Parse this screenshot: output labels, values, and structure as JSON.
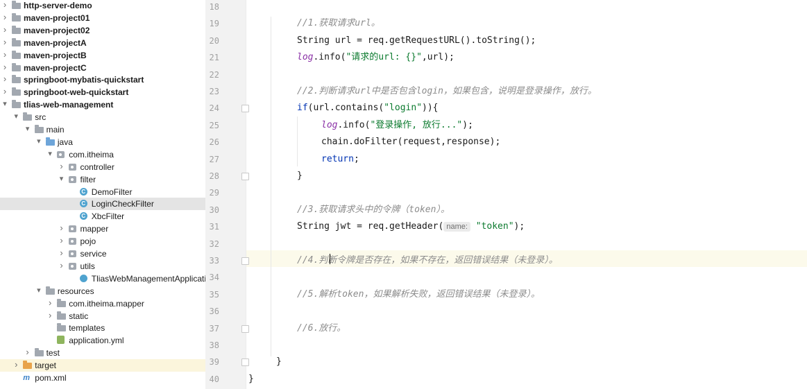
{
  "project_tree": {
    "items": [
      {
        "label": "http-server-demo",
        "bold": true,
        "level": 0,
        "arrow": "›",
        "icon": "folder"
      },
      {
        "label": "maven-project01",
        "bold": true,
        "level": 0,
        "arrow": "›",
        "icon": "folder"
      },
      {
        "label": "maven-project02",
        "bold": true,
        "level": 0,
        "arrow": "›",
        "icon": "folder"
      },
      {
        "label": "maven-projectA",
        "bold": true,
        "level": 0,
        "arrow": "›",
        "icon": "folder"
      },
      {
        "label": "maven-projectB",
        "bold": true,
        "level": 0,
        "arrow": "›",
        "icon": "folder"
      },
      {
        "label": "maven-projectC",
        "bold": true,
        "level": 0,
        "arrow": "›",
        "icon": "folder"
      },
      {
        "label": "springboot-mybatis-quickstart",
        "bold": true,
        "level": 0,
        "arrow": "›",
        "icon": "folder"
      },
      {
        "label": "springboot-web-quickstart",
        "bold": true,
        "level": 0,
        "arrow": "›",
        "icon": "folder"
      },
      {
        "label": "tlias-web-management",
        "bold": true,
        "level": 0,
        "arrow": "⌄",
        "icon": "folder"
      },
      {
        "label": "src",
        "bold": false,
        "level": 1,
        "arrow": "⌄",
        "icon": "folder"
      },
      {
        "label": "main",
        "bold": false,
        "level": 2,
        "arrow": "⌄",
        "icon": "folder"
      },
      {
        "label": "java",
        "bold": false,
        "level": 3,
        "arrow": "⌄",
        "icon": "folder-blue"
      },
      {
        "label": "com.itheima",
        "bold": false,
        "level": 4,
        "arrow": "⌄",
        "icon": "package"
      },
      {
        "label": "controller",
        "bold": false,
        "level": 5,
        "arrow": "›",
        "icon": "package"
      },
      {
        "label": "filter",
        "bold": false,
        "level": 5,
        "arrow": "⌄",
        "icon": "package"
      },
      {
        "label": "DemoFilter",
        "bold": false,
        "level": 6,
        "arrow": "",
        "icon": "class"
      },
      {
        "label": "LoginCheckFilter",
        "bold": false,
        "level": 6,
        "arrow": "",
        "icon": "class",
        "selected": true
      },
      {
        "label": "XbcFilter",
        "bold": false,
        "level": 6,
        "arrow": "",
        "icon": "class"
      },
      {
        "label": "mapper",
        "bold": false,
        "level": 5,
        "arrow": "›",
        "icon": "package"
      },
      {
        "label": "pojo",
        "bold": false,
        "level": 5,
        "arrow": "›",
        "icon": "package"
      },
      {
        "label": "service",
        "bold": false,
        "level": 5,
        "arrow": "›",
        "icon": "package"
      },
      {
        "label": "utils",
        "bold": false,
        "level": 5,
        "arrow": "›",
        "icon": "package"
      },
      {
        "label": "TliasWebManagementApplication",
        "bold": false,
        "level": 6,
        "arrow": "",
        "icon": "app"
      },
      {
        "label": "resources",
        "bold": false,
        "level": 3,
        "arrow": "⌄",
        "icon": "folder"
      },
      {
        "label": "com.itheima.mapper",
        "bold": false,
        "level": 4,
        "arrow": "›",
        "icon": "folder"
      },
      {
        "label": "static",
        "bold": false,
        "level": 4,
        "arrow": "›",
        "icon": "folder"
      },
      {
        "label": "templates",
        "bold": false,
        "level": 4,
        "arrow": "",
        "icon": "folder"
      },
      {
        "label": "application.yml",
        "bold": false,
        "level": 4,
        "arrow": "",
        "icon": "yml"
      },
      {
        "label": "test",
        "bold": false,
        "level": 2,
        "arrow": "›",
        "icon": "folder"
      },
      {
        "label": "target",
        "bold": false,
        "level": 1,
        "arrow": "›",
        "icon": "folder-orange",
        "highlight": true
      },
      {
        "label": "pom.xml",
        "bold": false,
        "level": 1,
        "arrow": "",
        "icon": "maven"
      }
    ]
  },
  "editor": {
    "lines": [
      {
        "num": "18",
        "segments": []
      },
      {
        "num": "19",
        "segments": [
          {
            "t": "//1.获取请求url。",
            "c": "cmt"
          }
        ]
      },
      {
        "num": "20",
        "segments": [
          {
            "t": "String url = req.getRequestURL().toString();",
            "c": ""
          }
        ]
      },
      {
        "num": "21",
        "segments": [
          {
            "t": "log",
            "c": "fld"
          },
          {
            "t": ".info(",
            "c": ""
          },
          {
            "t": "\"请求的url: {}\"",
            "c": "str"
          },
          {
            "t": ",url);",
            "c": ""
          }
        ]
      },
      {
        "num": "22",
        "segments": []
      },
      {
        "num": "23",
        "segments": [
          {
            "t": "//2.判断请求url中是否包含login，如果包含，说明是登录操作，放行。",
            "c": "cmt"
          }
        ]
      },
      {
        "num": "24",
        "segments": [
          {
            "t": "if",
            "c": "kw"
          },
          {
            "t": "(url.contains(",
            "c": ""
          },
          {
            "t": "\"login\"",
            "c": "str"
          },
          {
            "t": ")){",
            "c": ""
          }
        ]
      },
      {
        "num": "25",
        "segments": [
          {
            "t": "log",
            "c": "fld"
          },
          {
            "t": ".info(",
            "c": ""
          },
          {
            "t": "\"登录操作, 放行...\"",
            "c": "str"
          },
          {
            "t": ");",
            "c": ""
          }
        ]
      },
      {
        "num": "26",
        "segments": [
          {
            "t": "chain.doFilter(request,response);",
            "c": ""
          }
        ]
      },
      {
        "num": "27",
        "segments": [
          {
            "t": "return",
            "c": "kw"
          },
          {
            "t": ";",
            "c": ""
          }
        ]
      },
      {
        "num": "28",
        "segments": [
          {
            "t": "}",
            "c": ""
          }
        ]
      },
      {
        "num": "29",
        "segments": []
      },
      {
        "num": "30",
        "segments": [
          {
            "t": "//3.获取请求头中的令牌（token）。",
            "c": "cmt"
          }
        ]
      },
      {
        "num": "31",
        "segments": [
          {
            "t": "String jwt = req.getHeader(",
            "c": ""
          },
          {
            "t": "name:",
            "c": "hint"
          },
          {
            "t": "\"token\"",
            "c": "str"
          },
          {
            "t": ");",
            "c": ""
          }
        ]
      },
      {
        "num": "32",
        "segments": []
      },
      {
        "num": "33",
        "segments": [
          {
            "t": "//4.判断令牌是否存在，如果不存在，返回错误结果（未登录）。",
            "c": "cmt"
          }
        ]
      },
      {
        "num": "34",
        "segments": []
      },
      {
        "num": "35",
        "segments": [
          {
            "t": "//5.解析token，如果解析失败，返回错误结果（未登录）。",
            "c": "cmt"
          }
        ]
      },
      {
        "num": "36",
        "segments": []
      },
      {
        "num": "37",
        "segments": [
          {
            "t": "//6.放行。",
            "c": "cmt"
          }
        ]
      },
      {
        "num": "38",
        "segments": []
      },
      {
        "num": "39",
        "segments": [
          {
            "t": "}",
            "c": ""
          }
        ]
      },
      {
        "num": "40",
        "segments": [
          {
            "t": "}",
            "c": ""
          }
        ]
      }
    ]
  }
}
